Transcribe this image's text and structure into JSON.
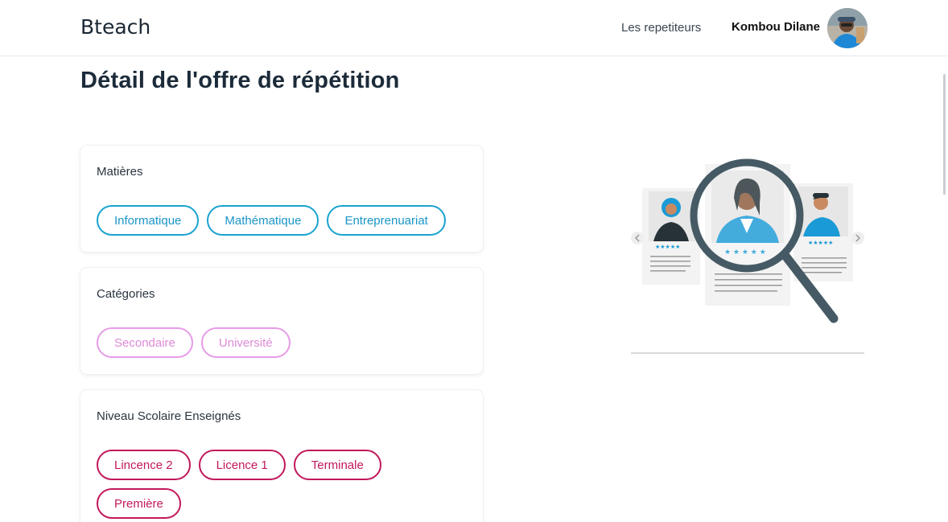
{
  "navbar": {
    "brand": "Bteach",
    "link_tutors": "Les repetiteurs",
    "user_name": "Kombou Dilane",
    "avatar_icon": "user-avatar-icon"
  },
  "page": {
    "title": "Détail de l'offre de répétition"
  },
  "sections": [
    {
      "title": "Matières",
      "tags": [
        "Informatique",
        "Mathématique",
        "Entreprenuariat"
      ],
      "color": "#1aa3cf"
    },
    {
      "title": "Catégories",
      "tags": [
        "Secondaire",
        "Université"
      ],
      "color": "#e79be8"
    },
    {
      "title": "Niveau Scolaire Enseignés",
      "tags": [
        "Lincence 2",
        "Licence 1",
        "Terminale",
        "Première"
      ],
      "color": "#c2185b"
    }
  ],
  "illustration": {
    "icon": "candidate-search-magnifier-illustration"
  }
}
